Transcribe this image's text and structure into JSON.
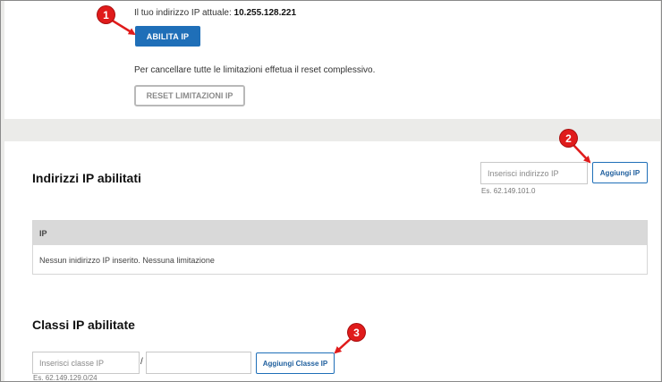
{
  "top": {
    "ip_label": "Il tuo indirizzo IP attuale:",
    "ip_value": "10.255.128.221",
    "enable_button": "ABILITA IP",
    "reset_text": "Per cancellare tutte le limitazioni effetua il reset complessivo.",
    "reset_button": "RESET LIMITAZIONI IP"
  },
  "enabled_ips": {
    "title": "Indirizzi IP abilitati",
    "input_value": "",
    "input_placeholder": "Inserisci indirizzo IP",
    "hint": "Es. 62.149.101.0",
    "add_button": "Aggiungi IP",
    "table": {
      "columns": [
        "IP"
      ],
      "rows": [
        "Nessun inidirizzo IP inserito. Nessuna limitazione"
      ]
    }
  },
  "ip_classes": {
    "title": "Classi IP abilitate",
    "class_input_value": "",
    "class_input_placeholder": "Inserisci classe IP",
    "separator": "/",
    "mask_input_value": "",
    "mask_input_placeholder": "",
    "hint": "Es. 62.149.129.0/24",
    "add_button": "Aggiungi Classe IP"
  },
  "annotations": {
    "markers": [
      "1",
      "2",
      "3"
    ],
    "color": "#e01b1b"
  },
  "colors": {
    "primary": "#1f6fb8",
    "background": "#ebebe9",
    "table_header": "#d9d9d9"
  }
}
